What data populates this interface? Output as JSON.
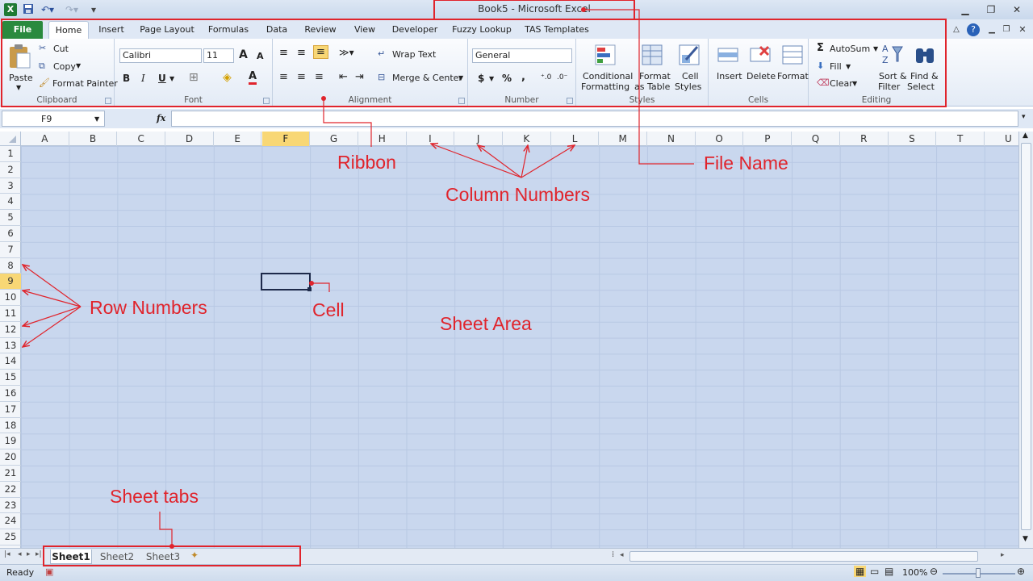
{
  "window": {
    "title": "Book5  -  Microsoft Excel",
    "excel_logo_letter": "X"
  },
  "qat": {
    "save_icon": "save-icon",
    "undo_icon": "undo-icon",
    "redo_icon": "redo-icon",
    "customize_icon": "customize-icon"
  },
  "tabs": [
    {
      "label": "File"
    },
    {
      "label": "Home"
    },
    {
      "label": "Insert"
    },
    {
      "label": "Page Layout"
    },
    {
      "label": "Formulas"
    },
    {
      "label": "Data"
    },
    {
      "label": "Review"
    },
    {
      "label": "View"
    },
    {
      "label": "Developer"
    },
    {
      "label": "Fuzzy Lookup"
    },
    {
      "label": "TAS Templates"
    }
  ],
  "ribbon": {
    "clipboard": {
      "group": "Clipboard",
      "paste": "Paste",
      "cut": "Cut",
      "copy": "Copy",
      "format_painter": "Format Painter"
    },
    "font": {
      "group": "Font",
      "name": "Calibri",
      "size": "11",
      "bold": "B",
      "italic": "I",
      "underline": "U",
      "grow": "A",
      "shrink": "A",
      "color_letter": "A"
    },
    "alignment": {
      "group": "Alignment",
      "wrap": "Wrap Text",
      "merge": "Merge & Center"
    },
    "number": {
      "group": "Number",
      "format": "General",
      "currency": "$",
      "percent": "%",
      "comma": ","
    },
    "styles": {
      "group": "Styles",
      "conditional_1": "Conditional",
      "conditional_2": "Formatting",
      "format_table_1": "Format",
      "format_table_2": "as Table",
      "cell_styles_1": "Cell",
      "cell_styles_2": "Styles"
    },
    "cells": {
      "group": "Cells",
      "insert": "Insert",
      "delete": "Delete",
      "format": "Format"
    },
    "editing": {
      "group": "Editing",
      "autosum": "AutoSum",
      "fill": "Fill",
      "clear": "Clear",
      "sort_1": "Sort &",
      "sort_2": "Filter",
      "find_1": "Find &",
      "find_2": "Select"
    }
  },
  "formula_bar": {
    "name_box": "F9",
    "fx": "fx",
    "content": ""
  },
  "columns": [
    "A",
    "B",
    "C",
    "D",
    "E",
    "F",
    "G",
    "H",
    "I",
    "J",
    "K",
    "L",
    "M",
    "N",
    "O",
    "P",
    "Q",
    "R",
    "S",
    "T",
    "U"
  ],
  "rows": [
    "1",
    "2",
    "3",
    "4",
    "5",
    "6",
    "7",
    "8",
    "9",
    "10",
    "11",
    "12",
    "13",
    "14",
    "15",
    "16",
    "17",
    "18",
    "19",
    "20",
    "21",
    "22",
    "23",
    "24",
    "25"
  ],
  "selected_cell": {
    "column": "F",
    "row": "9"
  },
  "sheet_tabs": [
    {
      "label": "Sheet1",
      "active": true
    },
    {
      "label": "Sheet2"
    },
    {
      "label": "Sheet3"
    }
  ],
  "status": {
    "ready": "Ready",
    "zoom": "100%"
  },
  "annotations": {
    "ribbon": "Ribbon",
    "file_name": "File Name",
    "column_numbers": "Column Numbers",
    "row_numbers": "Row Numbers",
    "cell": "Cell",
    "sheet_area": "Sheet Area",
    "sheet_tabs": "Sheet tabs"
  },
  "colors": {
    "annotation": "#e0242c",
    "selection": "#f8d775",
    "sheet_bg": "#c9d7ee",
    "file_tab": "#2a8a3e"
  }
}
